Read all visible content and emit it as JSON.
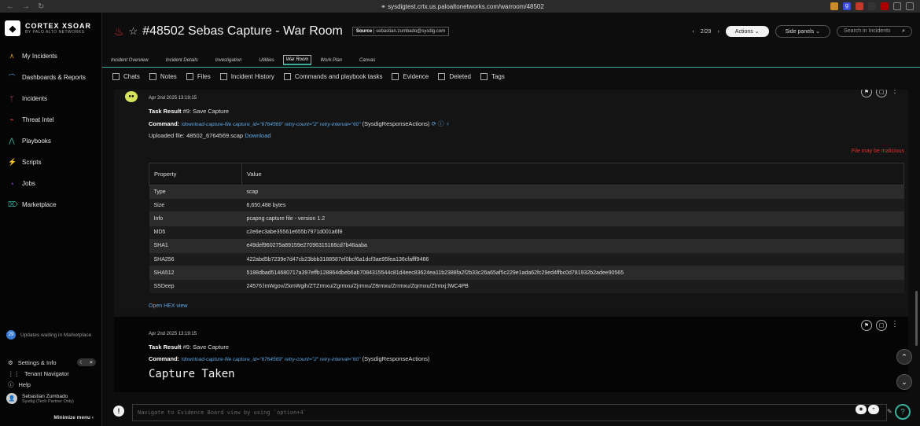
{
  "browser": {
    "url": "sysdigtest.crtx.us.paloaltonetworks.com/warroom/48502"
  },
  "brand": {
    "name": "CORTEX XSOAR",
    "sub": "BY PALO ALTO NETWORKS"
  },
  "sidebar": {
    "items": [
      {
        "label": "My Incidents",
        "icon": "incident-icon"
      },
      {
        "label": "Dashboards & Reports",
        "icon": "dashboard-icon"
      },
      {
        "label": "Incidents",
        "icon": "incidents-icon"
      },
      {
        "label": "Threat Intel",
        "icon": "threat-icon"
      },
      {
        "label": "Playbooks",
        "icon": "playbook-icon"
      },
      {
        "label": "Scripts",
        "icon": "scripts-icon"
      },
      {
        "label": "Jobs",
        "icon": "jobs-icon"
      },
      {
        "label": "Marketplace",
        "icon": "marketplace-icon"
      }
    ],
    "updates_count": "29",
    "updates_text": "Updates waiting in Marketplace",
    "settings": "Settings & Info",
    "tenant": "Tenant Navigator",
    "help": "Help",
    "user_name": "Sebastian Zumbado",
    "user_org": "Sysdig (Tech Partner Only)",
    "minimize": "Minimize menu"
  },
  "header": {
    "title": "#48502  Sebas Capture - War Room",
    "source_label": "Source",
    "source_value": "sebastian.zumbado@sysdig.com",
    "pager": "2/29",
    "actions": "Actions",
    "side_panels": "Side panels",
    "search_placeholder": "Search in Incidents"
  },
  "tabs": [
    "Incident Overview",
    "Incident Details",
    "Investigation",
    "Utilities",
    "War Room",
    "Work Plan",
    "Canvas"
  ],
  "filters": [
    "Chats",
    "Notes",
    "Files",
    "Incident History",
    "Commands and playbook tasks",
    "Evidence",
    "Deleted",
    "Tags"
  ],
  "entry1": {
    "timestamp": "Apr 2nd 2025 13:19:15",
    "task_label": "Task Result",
    "task_value": "#9: Save Capture",
    "command_label": "Command:",
    "command": "!download-capture-file capture_id=\"6764569\" retry-count=\"2\" retry-interval=\"60\"",
    "command_source": "(SysdigResponseActions)",
    "uploaded_prefix": "Uploaded file: 48502_6764569.scap",
    "download": "Download",
    "warning": "File may be malicious",
    "table_headers": [
      "Property",
      "Value"
    ],
    "rows": [
      [
        "Type",
        "scap"
      ],
      [
        "Size",
        "6,650,488 bytes"
      ],
      [
        "Info",
        "pcapng capture file - version 1.2"
      ],
      [
        "MD5",
        "c2e6ec3abe35561e655b7971d001a6f8"
      ],
      [
        "SHA1",
        "e49def960275a89159e27096315166cd7b46aaba"
      ],
      [
        "SHA256",
        "422abd5b7239e7d47cb23bbb3188587ef0bcf6a1dcf3ae95fea136cfafff9466"
      ],
      [
        "SHA512",
        "5188dbad514680717a397effb128864dbeb6ab7084315544c81d4eec83624ea11b2388fa2f2b33c26a65af5c229e1ada62fc29ed4ffbc0d781932b2adee90565"
      ],
      [
        "SSDeep",
        "24576:lmWgov/ZkmWgih/ZTZrmxu/Zgrmxu/Zjrmxu/Z8rmxu/Zrrmxu/Zqrmxu/Zlrmxj:lWC4PB"
      ]
    ],
    "hex_link": "Open HEX view"
  },
  "entry2": {
    "timestamp": "Apr 2nd 2025 13:19:15",
    "task_label": "Task Result",
    "task_value": "#9: Save Capture",
    "command_label": "Command:",
    "command": "!download-capture-file capture_id=\"6764569\" retry-count=\"2\" retry-interval=\"60\"",
    "command_source": "(SysdigResponseActions)",
    "heading": "Capture Taken"
  },
  "footer": {
    "cli_placeholder": "Navigate to Evidence Board view by using `option+4`"
  },
  "colors": {
    "accent": "#3bb09d",
    "link": "#5fa8e6",
    "danger": "#e03030"
  }
}
